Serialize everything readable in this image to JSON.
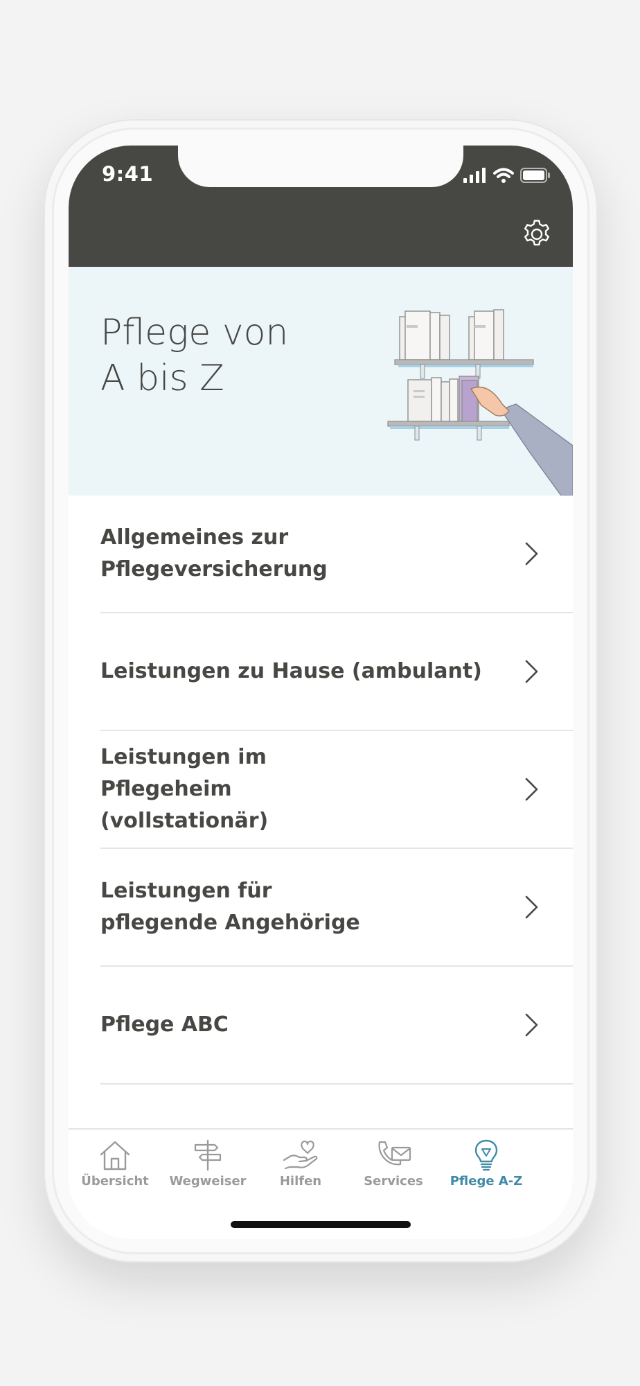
{
  "status_bar": {
    "time": "9:41"
  },
  "header": {
    "settings_icon": "gear-icon"
  },
  "hero": {
    "title_line1": "Pflege von",
    "title_line2": "A bis Z",
    "illustration": "bookshelf-hand-illustration"
  },
  "list": {
    "items": [
      {
        "label": "Allgemeines zur Pflegeversicherung"
      },
      {
        "label": "Leistungen zu Hause (ambulant)"
      },
      {
        "label": "Leistungen im Pflegeheim (vollstationär)"
      },
      {
        "label": "Leistungen für pflegende Angehörige"
      },
      {
        "label": "Pflege ABC"
      }
    ]
  },
  "tabbar": {
    "tabs": [
      {
        "label": "Übersicht",
        "icon": "home-icon"
      },
      {
        "label": "Wegweiser",
        "icon": "signpost-icon"
      },
      {
        "label": "Hilfen",
        "icon": "heart-hand-icon"
      },
      {
        "label": "Services",
        "icon": "phone-mail-icon"
      },
      {
        "label": "Pflege A-Z",
        "icon": "lightbulb-icon",
        "active": true
      }
    ]
  },
  "colors": {
    "header_bg": "#474744",
    "hero_bg": "#ecf5f8",
    "text": "#474744",
    "accent": "#3f8aa8",
    "tab_inactive": "#9a9a9a"
  }
}
